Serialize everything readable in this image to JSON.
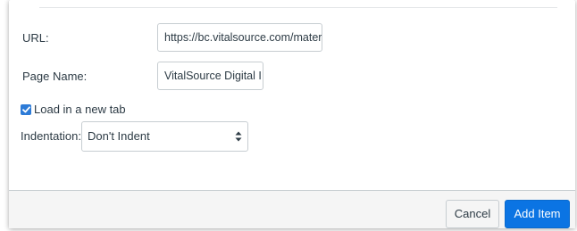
{
  "form": {
    "url_label": "URL:",
    "url_value": "https://bc.vitalsource.com/mater",
    "page_name_label": "Page Name:",
    "page_name_value": "VitalSource Digital I",
    "new_tab_label": "Load in a new tab",
    "new_tab_checked": true,
    "indentation_label": "Indentation:",
    "indentation_value": "Don't Indent"
  },
  "footer": {
    "cancel_label": "Cancel",
    "add_label": "Add Item"
  },
  "colors": {
    "primary": "#0b74e3",
    "checkbox": "#2d7bd7",
    "text": "#2d3b45",
    "footer_bg": "#f5f5f5"
  },
  "icons": {
    "checkbox": "checkmark-icon",
    "select": "select-arrows-icon"
  }
}
